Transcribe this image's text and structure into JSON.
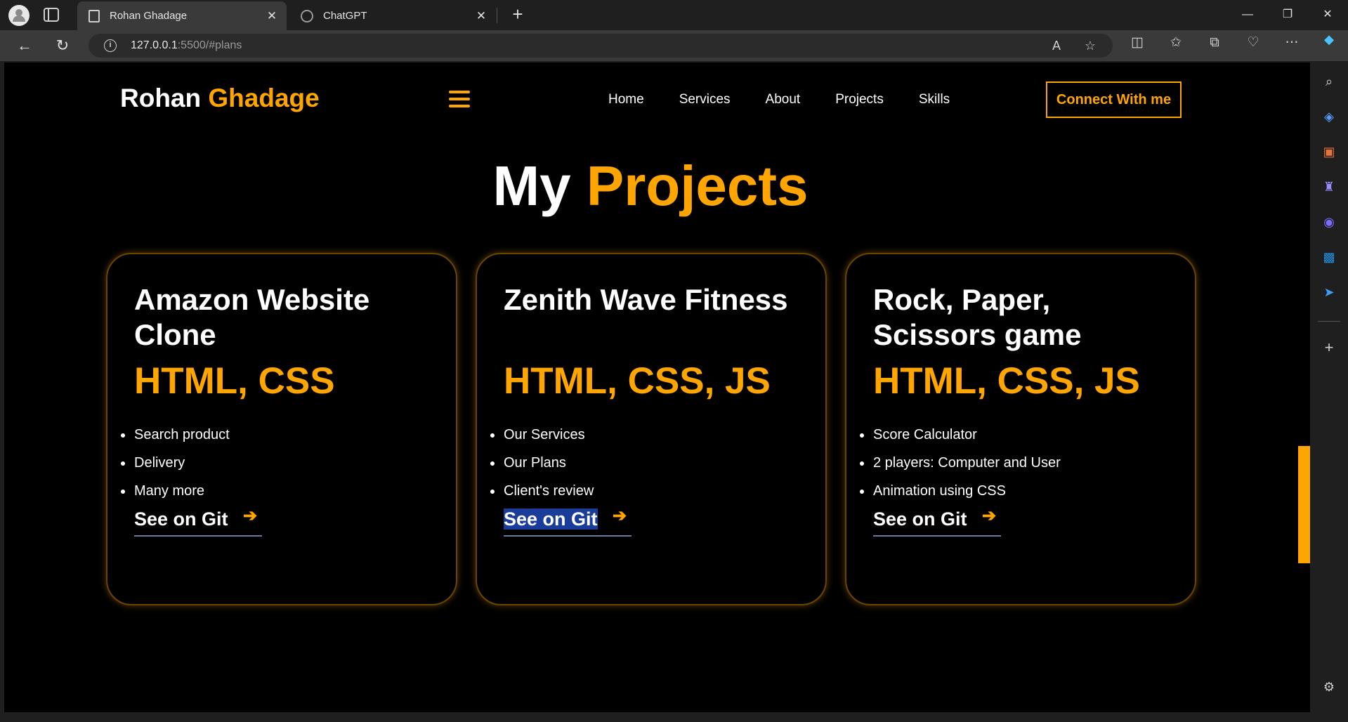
{
  "browser": {
    "tabs": [
      {
        "title": "Rohan Ghadage",
        "active": true
      },
      {
        "title": "ChatGPT",
        "active": false
      }
    ],
    "url": {
      "host": "127.0.0.1",
      "path": ":5500/#plans"
    },
    "window_controls": {
      "minimize": "—",
      "restore": "❐",
      "close": "✕"
    }
  },
  "site": {
    "brand": {
      "first": "Rohan",
      "last": "Ghadage"
    },
    "nav": [
      "Home",
      "Services",
      "About",
      "Projects",
      "Skills"
    ],
    "cta": "Connect With me",
    "section_title": {
      "first": "My",
      "accent": "Projects"
    },
    "projects": [
      {
        "title": "Amazon Website Clone",
        "tech": "HTML, CSS",
        "features": [
          "Search product",
          "Delivery",
          "Many more"
        ],
        "link": "See on Git"
      },
      {
        "title": "Zenith Wave Fitness",
        "tech": "HTML, CSS, JS",
        "features": [
          "Our Services",
          "Our Plans",
          "Client's review"
        ],
        "link": "See on Git"
      },
      {
        "title": "Rock, Paper, Scissors game",
        "tech": "HTML, CSS, JS",
        "features": [
          "Score Calculator",
          "2 players: Computer and User",
          "Animation using CSS"
        ],
        "link": "See on Git"
      }
    ]
  },
  "colors": {
    "accent": "#ffa500",
    "background": "#000000",
    "selection": "#1a3d9a"
  }
}
